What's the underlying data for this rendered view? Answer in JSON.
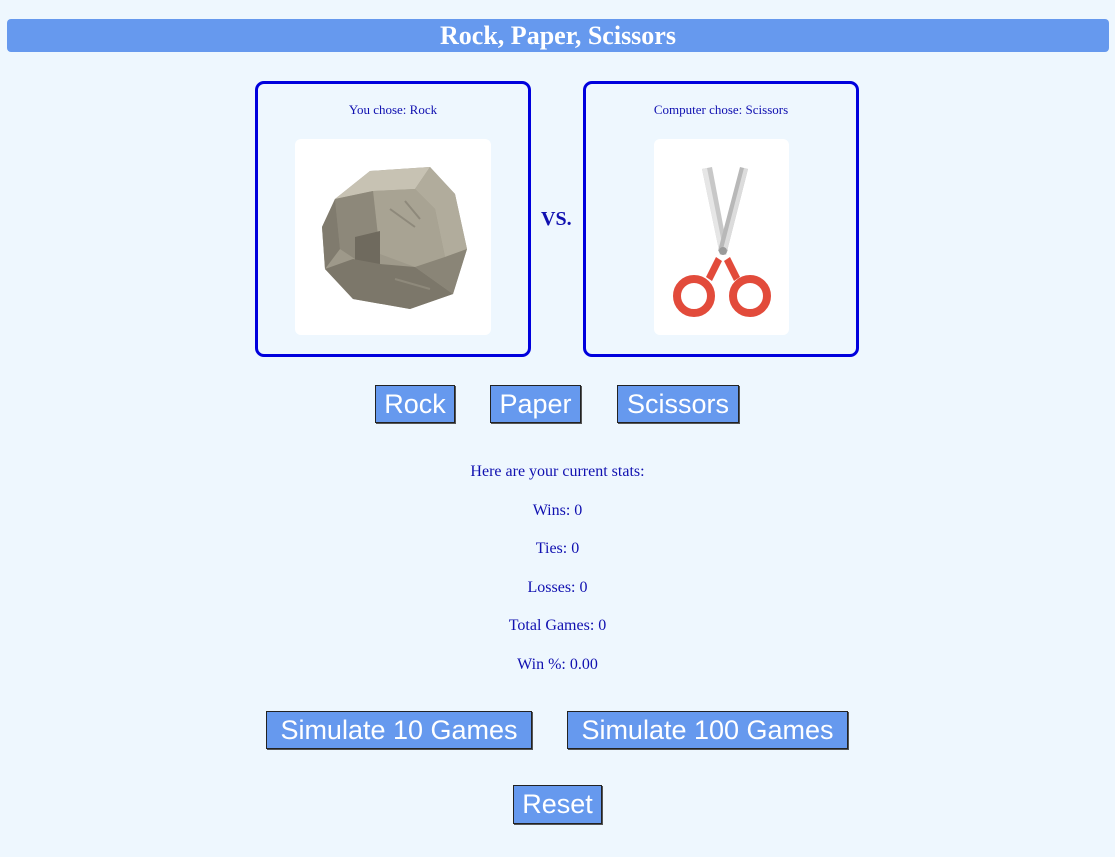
{
  "header": {
    "title": "Rock, Paper, Scissors"
  },
  "player": {
    "label": "You chose: Rock",
    "choice_icon": "rock-icon"
  },
  "computer": {
    "label": "Computer chose: Scissors",
    "choice_icon": "scissors-icon"
  },
  "versus": "VS.",
  "choices": {
    "rock": "Rock",
    "paper": "Paper",
    "scissors": "Scissors"
  },
  "stats": {
    "intro": "Here are your current stats:",
    "wins": "Wins: 0",
    "ties": "Ties: 0",
    "losses": "Losses: 0",
    "total": "Total Games: 0",
    "win_pct": "Win %: 0.00"
  },
  "actions": {
    "simulate10": "Simulate 10 Games",
    "simulate100": "Simulate 100 Games",
    "reset": "Reset"
  },
  "colors": {
    "background": "#eef7fe",
    "accent": "#6699ee",
    "panel_border": "#0000dd",
    "text": "#1010b0"
  }
}
